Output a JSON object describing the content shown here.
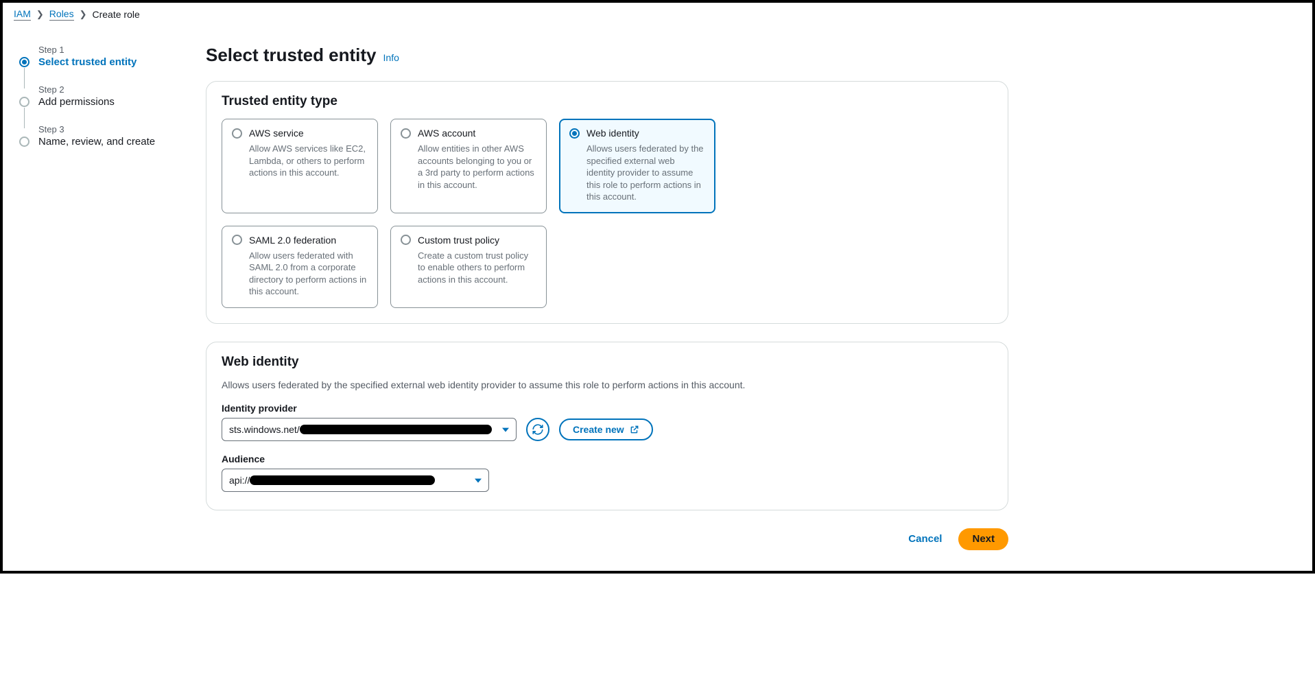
{
  "breadcrumb": {
    "iam": "IAM",
    "roles": "Roles",
    "current": "Create role"
  },
  "stepper": {
    "step1num": "Step 1",
    "step1label": "Select trusted entity",
    "step2num": "Step 2",
    "step2label": "Add permissions",
    "step3num": "Step 3",
    "step3label": "Name, review, and create"
  },
  "heading": {
    "title": "Select trusted entity",
    "info": "Info"
  },
  "entityPanel": {
    "title": "Trusted entity type",
    "cards": {
      "aws_service": {
        "title": "AWS service",
        "desc": "Allow AWS services like EC2, Lambda, or others to perform actions in this account."
      },
      "aws_account": {
        "title": "AWS account",
        "desc": "Allow entities in other AWS accounts belonging to you or a 3rd party to perform actions in this account."
      },
      "web_identity": {
        "title": "Web identity",
        "desc": "Allows users federated by the specified external web identity provider to assume this role to perform actions in this account."
      },
      "saml": {
        "title": "SAML 2.0 federation",
        "desc": "Allow users federated with SAML 2.0 from a corporate directory to perform actions in this account."
      },
      "custom": {
        "title": "Custom trust policy",
        "desc": "Create a custom trust policy to enable others to perform actions in this account."
      }
    }
  },
  "webIdentity": {
    "title": "Web identity",
    "subtitle": "Allows users federated by the specified external web identity provider to assume this role to perform actions in this account.",
    "idpLabel": "Identity provider",
    "idpPrefix": "sts.windows.net/",
    "idpRedacted": "████████████████████████████████████",
    "audienceLabel": "Audience",
    "audiencePrefix": "api://",
    "audienceRedacted": "██████████████████████████",
    "createNew": "Create new"
  },
  "footer": {
    "cancel": "Cancel",
    "next": "Next"
  }
}
